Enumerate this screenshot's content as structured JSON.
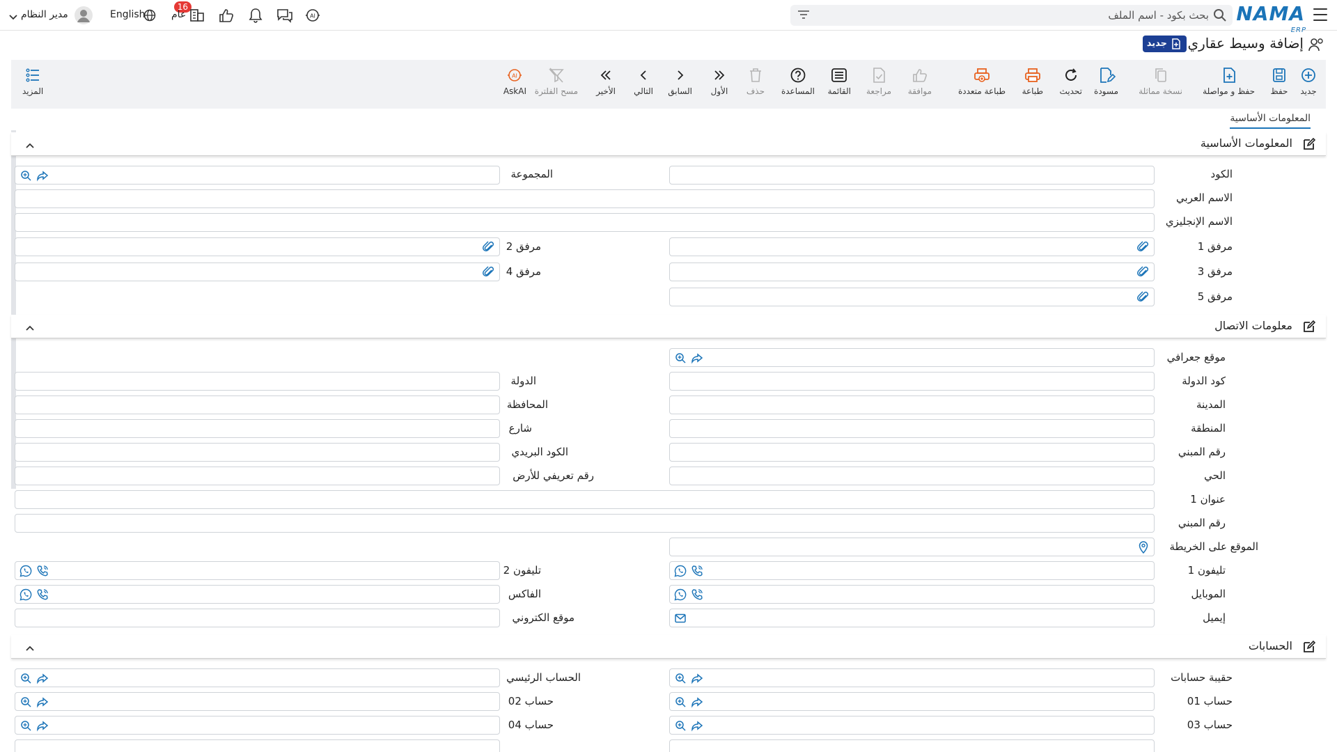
{
  "topbar": {
    "logo_text": "NAMA",
    "logo_sub": "ERP",
    "search_placeholder": "بحث بكود - اسم الملف",
    "notification_count": "16",
    "scope_label": "عام",
    "language_label": "English",
    "user_name": "مدير النظام"
  },
  "page": {
    "title": "إضافة وسيط عقاري",
    "status_badge": "جديد"
  },
  "toolbar": {
    "new": "جديد",
    "save": "حفظ",
    "save_continue": "حفظ و مواصلة",
    "duplicate": "نسخة مماثلة",
    "draft": "مسودة",
    "refresh": "تحديث",
    "print": "طباعة",
    "multi_print": "طباعة متعددة",
    "approve": "موافقة",
    "review": "مراجعة",
    "list": "القائمة",
    "help": "المساعدة",
    "delete": "حذف",
    "first": "الأول",
    "previous": "السابق",
    "next": "التالي",
    "last": "الأخير",
    "clear_filter": "مسح الفلترة",
    "askai": "AskAI",
    "more": "المزيد"
  },
  "tabs": {
    "basic_info": "المعلومات الأساسية"
  },
  "sections": {
    "basic": {
      "title": "المعلومات الأساسية",
      "code": "الكود",
      "group": "المجموعة",
      "arabic_name": "الاسم العربي",
      "english_name": "الاسم الإنجليزي",
      "attachment1": "مرفق 1",
      "attachment2": "مرفق 2",
      "attachment3": "مرفق 3",
      "attachment4": "مرفق 4",
      "attachment5": "مرفق 5"
    },
    "contact": {
      "title": "معلومات الاتصال",
      "geo_location": "موقع جعرافي",
      "country_code": "كود الدولة",
      "country": "الدولة",
      "city": "المدينة",
      "governorate": "المحافظة",
      "region": "المنطقة",
      "street": "شارع",
      "building_number": "رقم المبني",
      "postal_code": "الكود البريدي",
      "district": "الحي",
      "land_id": "رقم تعريفي للأرض",
      "address1": "عنوان 1",
      "building_number2": "رقم المبني",
      "map_location": "الموقع على الخريطة",
      "phone1": "تليفون 1",
      "phone2": "تليفون 2",
      "mobile": "الموبايل",
      "fax": "الفاكس",
      "email": "إيميل",
      "website": "موقع الكتروني"
    },
    "accounts": {
      "title": "الحسابات",
      "accounts_bag": "حقيبة حسابات",
      "main_account": "الحساب الرئيسي",
      "account01": "حساب 01",
      "account02": "حساب 02",
      "account03": "حساب 03",
      "account04": "حساب 04"
    }
  },
  "colors": {
    "brand": "#1b74b8",
    "badge_bg": "#1c3f94",
    "notification": "#e53935",
    "print_orange": "#e8621f",
    "icon_blue": "#1b74b8"
  }
}
